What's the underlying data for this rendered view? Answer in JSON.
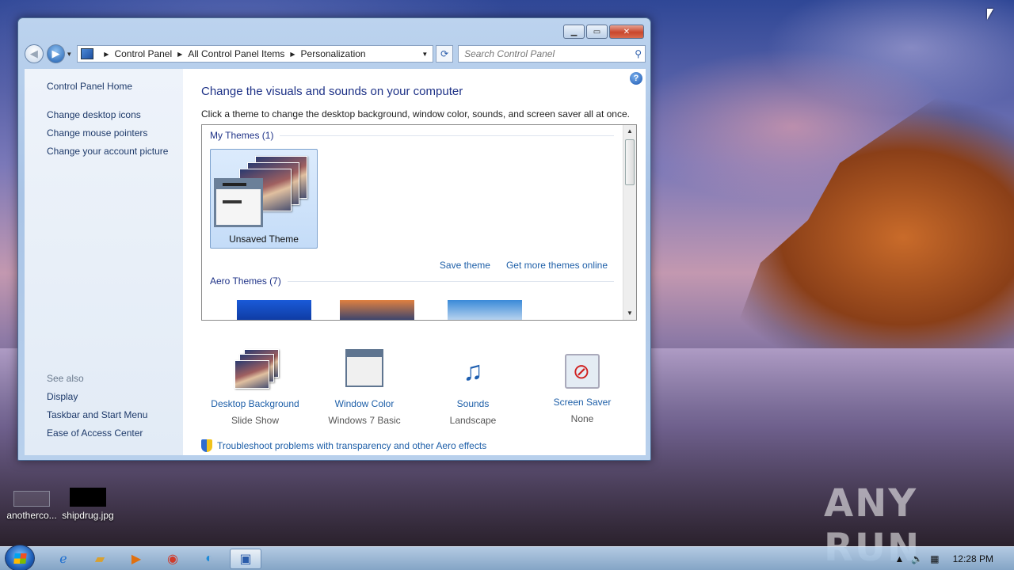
{
  "window": {
    "breadcrumb": [
      "Control Panel",
      "All Control Panel Items",
      "Personalization"
    ],
    "search_placeholder": "Search Control Panel",
    "help_label": "?"
  },
  "sidebar": {
    "home": "Control Panel Home",
    "links": [
      "Change desktop icons",
      "Change mouse pointers",
      "Change your account picture"
    ],
    "see_also_label": "See also",
    "see_also": [
      "Display",
      "Taskbar and Start Menu",
      "Ease of Access Center"
    ]
  },
  "main": {
    "title": "Change the visuals and sounds on your computer",
    "subtitle": "Click a theme to change the desktop background, window color, sounds, and screen saver all at once.",
    "my_themes_header": "My Themes (1)",
    "unsaved_theme": "Unsaved Theme",
    "save_theme": "Save theme",
    "get_more": "Get more themes online",
    "aero_header": "Aero Themes (7)",
    "items": [
      {
        "label": "Desktop Background",
        "value": "Slide Show",
        "icon": "desktop-background-icon"
      },
      {
        "label": "Window Color",
        "value": "Windows 7 Basic",
        "icon": "window-color-icon"
      },
      {
        "label": "Sounds",
        "value": "Landscape",
        "icon": "sounds-icon"
      },
      {
        "label": "Screen Saver",
        "value": "None",
        "icon": "screen-saver-icon"
      }
    ],
    "troubleshoot": "Troubleshoot problems with transparency and other Aero effects"
  },
  "desktop": {
    "icons": [
      "anotherco...",
      "shipdrug.jpg"
    ],
    "watermark": "ANY RUN"
  },
  "taskbar": {
    "clock": "12:28 PM",
    "apps": [
      "internet-explorer-icon",
      "file-explorer-icon",
      "media-player-icon",
      "chrome-icon",
      "edge-icon",
      "control-panel-icon"
    ]
  },
  "colors": {
    "link": "#1e5fa8",
    "heading": "#1e3287"
  }
}
